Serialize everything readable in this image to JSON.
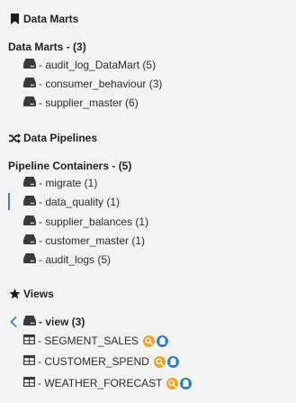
{
  "data_marts": {
    "header": "Data Marts",
    "group_title": "Data Marts - (3)",
    "items": [
      {
        "label": "- audit_log_DataMart (5)"
      },
      {
        "label": "- consumer_behaviour (3)"
      },
      {
        "label": "- supplier_master (6)"
      }
    ]
  },
  "data_pipelines": {
    "header": "Data Pipelines",
    "group_title": "Pipeline Containers - (5)",
    "items": [
      {
        "label": "- migrate (1)"
      },
      {
        "label": "- data_quality (1)"
      },
      {
        "label": "- supplier_balances (1)"
      },
      {
        "label": "- customer_master (1)"
      },
      {
        "label": "- audit_logs (5)"
      }
    ]
  },
  "views": {
    "header": "Views",
    "group_label": "- view (3)",
    "items": [
      {
        "label": "- SEGMENT_SALES"
      },
      {
        "label": "- CUSTOMER_SPEND"
      },
      {
        "label": "- WEATHER_FORECAST"
      }
    ]
  },
  "colors": {
    "accent": "#3b82c4",
    "search_badge": "#f0a51d",
    "info_badge": "#2f7cc8"
  },
  "icons": {
    "data_marts_header": "bookmark-icon",
    "data_pipelines_header": "shuffle-icon",
    "views_header": "star-icon",
    "item": "server-icon",
    "view_item": "table-icon"
  }
}
